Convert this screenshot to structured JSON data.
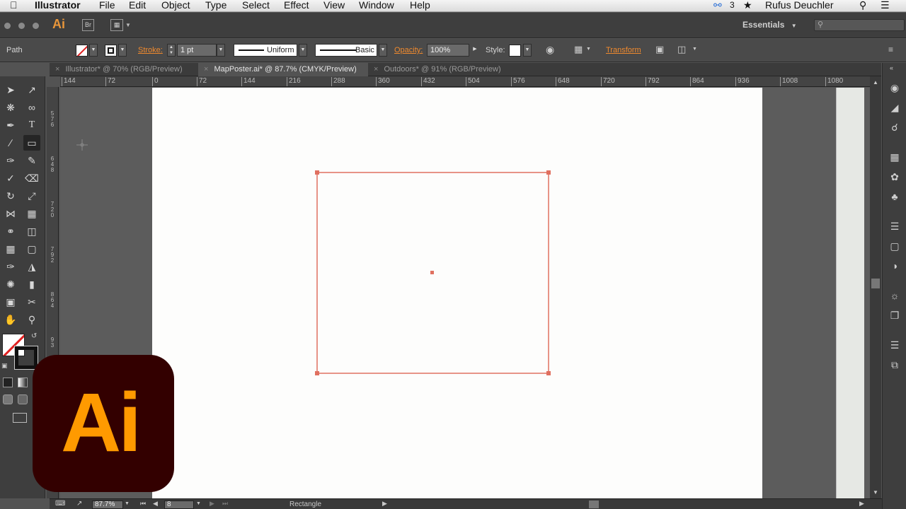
{
  "menubar": {
    "app": "Illustrator",
    "items": [
      "File",
      "Edit",
      "Object",
      "Type",
      "Select",
      "Effect",
      "View",
      "Window",
      "Help"
    ],
    "cc_count": "3",
    "user": "Rufus Deuchler"
  },
  "appbar": {
    "ai_label": "Ai",
    "bridge_label": "Br",
    "workspace": "Essentials"
  },
  "control": {
    "selection_type": "Path",
    "stroke_label": "Stroke:",
    "stroke_weight": "1 pt",
    "variable_width": "Uniform",
    "brush": "Basic",
    "opacity_label": "Opacity:",
    "opacity": "100%",
    "style_label": "Style:",
    "transform_label": "Transform"
  },
  "tabs": [
    {
      "label": "Illustrator* @ 70% (RGB/Preview)",
      "active": false
    },
    {
      "label": "MapPoster.ai* @ 87.7% (CMYK/Preview)",
      "active": true
    },
    {
      "label": "Outdoors* @ 91% (RGB/Preview)",
      "active": false
    }
  ],
  "ruler": {
    "h_ticks": [
      "144",
      "72",
      "0",
      "72",
      "144",
      "216",
      "288",
      "360",
      "432",
      "504",
      "576",
      "648",
      "720",
      "792",
      "864",
      "936",
      "1008",
      "1080"
    ],
    "v_ticks": [
      "5 7 6",
      "6 4 8",
      "7 2 0",
      "7 9 2",
      "8 6 4",
      "9 3"
    ]
  },
  "status": {
    "zoom": "87.7%",
    "artboard": "8",
    "tool": "Rectangle"
  },
  "logo_text": "Ai",
  "colors": {
    "selection": "#e07060",
    "accent": "#f08a2e",
    "logo_bg": "#330000",
    "logo_fg": "#ff9a00"
  }
}
